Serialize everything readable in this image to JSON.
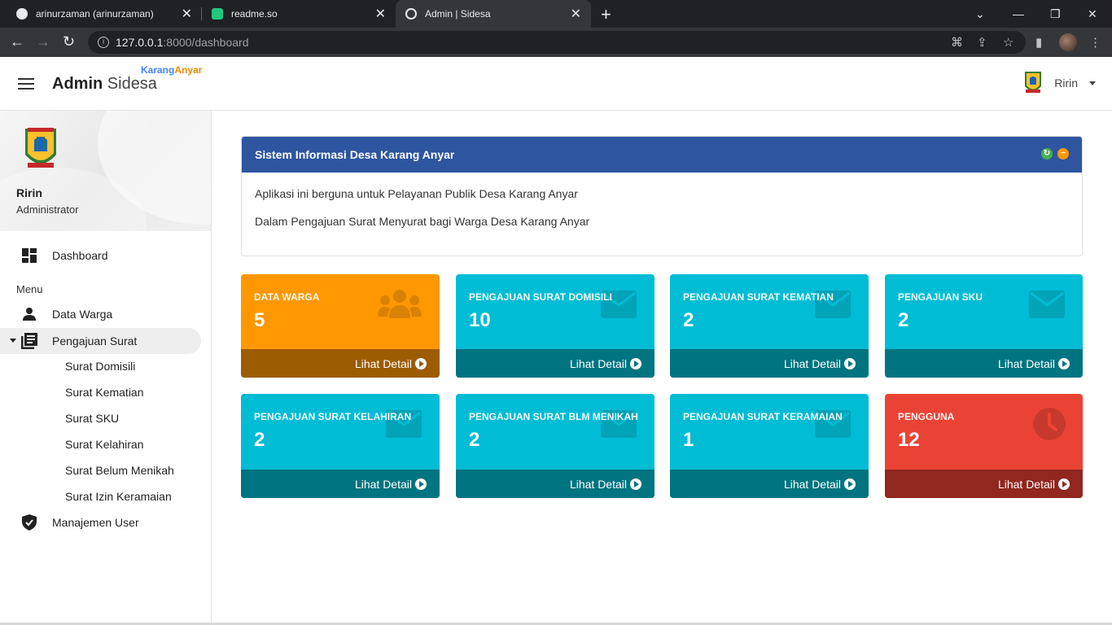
{
  "browser": {
    "tabs": [
      {
        "title": "arinurzaman (arinurzaman)"
      },
      {
        "title": "readme.so"
      },
      {
        "title": "Admin | Sidesa"
      }
    ],
    "url_host": "127.0.0.1",
    "url_path": ":8000/dashboard"
  },
  "header": {
    "brand_bold": "Admin",
    "brand_light": "Sidesa",
    "brand_sub_parts": [
      "Karang",
      "Anyar"
    ],
    "user_name": "Ririn"
  },
  "sidebar": {
    "user_name": "Ririn",
    "user_role": "Administrator",
    "dashboard_label": "Dashboard",
    "menu_header": "Menu",
    "items": [
      {
        "label": "Data Warga"
      },
      {
        "label": "Pengajuan Surat"
      },
      {
        "label": "Manajemen User"
      }
    ],
    "submenu": [
      "Surat Domisili",
      "Surat Kematian",
      "Surat SKU",
      "Surat Kelahiran",
      "Surat Belum Menikah",
      "Surat Izin Keramaian"
    ]
  },
  "info_card": {
    "title": "Sistem Informasi Desa Karang Anyar",
    "line1": "Aplikasi ini berguna untuk Pelayanan Publik Desa Karang Anyar",
    "line2": "Dalam Pengajuan Surat Menyurat bagi Warga Desa Karang Anyar"
  },
  "stats": [
    {
      "title": "DATA WARGA",
      "value": "5",
      "footer": "Lihat Detail",
      "color": "#ff9800",
      "icon": "users-icon"
    },
    {
      "title": "PENGAJUAN SURAT DOMISILI",
      "value": "10",
      "footer": "Lihat Detail",
      "color": "#00bcd4",
      "icon": "envelope-icon"
    },
    {
      "title": "PENGAJUAN SURAT KEMATIAN",
      "value": "2",
      "footer": "Lihat Detail",
      "color": "#00bcd4",
      "icon": "envelope-icon"
    },
    {
      "title": "PENGAJUAN SKU",
      "value": "2",
      "footer": "Lihat Detail",
      "color": "#00bcd4",
      "icon": "envelope-icon"
    },
    {
      "title": "PENGAJUAN SURAT KELAHIRAN",
      "value": "2",
      "footer": "Lihat Detail",
      "color": "#00bcd4",
      "icon": "envelope-icon"
    },
    {
      "title": "PENGAJUAN SURAT BLM MENIKAH",
      "value": "2",
      "footer": "Lihat Detail",
      "color": "#00bcd4",
      "icon": "envelope-icon"
    },
    {
      "title": "PENGAJUAN SURAT KERAMAIAN",
      "value": "1",
      "footer": "Lihat Detail",
      "color": "#00bcd4",
      "icon": "envelope-icon"
    },
    {
      "title": "PENGGUNA",
      "value": "12",
      "footer": "Lihat Detail",
      "color": "#ea4335",
      "icon": "clock-icon"
    }
  ]
}
